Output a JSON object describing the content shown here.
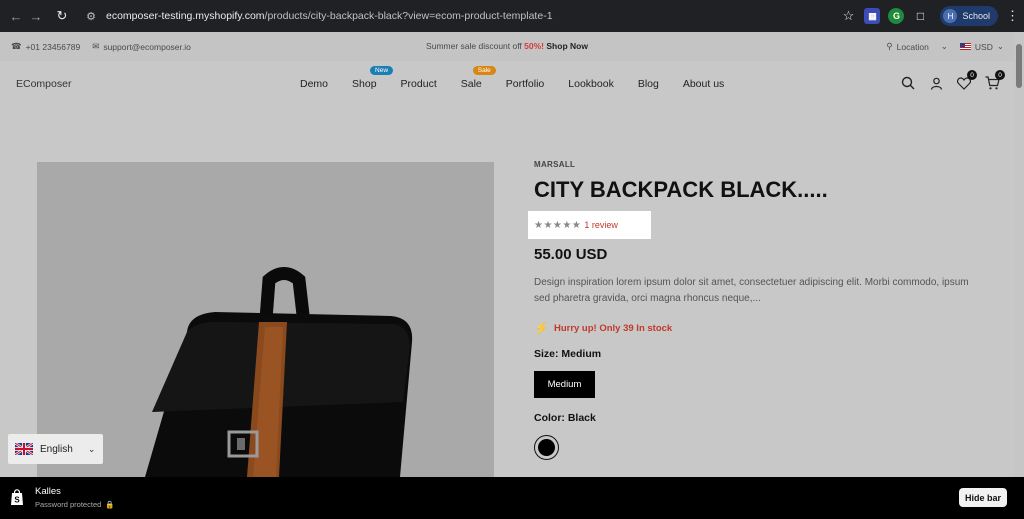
{
  "browser": {
    "url_host": "ecomposer-testing.myshopify.com",
    "url_path": "/products/city-backpack-black?view=ecom-product-template-1",
    "profile_initial": "H",
    "profile_name": "School"
  },
  "topbar": {
    "phone": "+01 23456789",
    "email": "support@ecomposer.io",
    "promo_prefix": "Summer sale discount off ",
    "promo_percent": "50%!",
    "promo_link": "Shop Now",
    "location": "Location",
    "currency": "USD"
  },
  "header": {
    "logo": "EComposer",
    "menu": [
      {
        "label": "Demo"
      },
      {
        "label": "Shop",
        "badge": "New"
      },
      {
        "label": "Product"
      },
      {
        "label": "Sale",
        "badge": "Sale"
      },
      {
        "label": "Portfolio"
      },
      {
        "label": "Lookbook"
      },
      {
        "label": "Blog"
      },
      {
        "label": "About us"
      }
    ],
    "wishlist_count": "0",
    "cart_count": "0"
  },
  "product": {
    "brand": "MARSALL",
    "title": "CITY BACKPACK BLACK.....",
    "rating": 5,
    "review_text": "1 review",
    "price": "55.00 USD",
    "description": "Design inspiration lorem ipsum dolor sit amet, consectetuer adipiscing elit. Morbi commodo, ipsum sed pharetra gravida, orci magna rhoncus neque,...",
    "stock_text": "Hurry up! Only 39 In stock",
    "size_label": "Size: Medium",
    "size_option": "Medium",
    "color_label": "Color: Black"
  },
  "language": {
    "selected": "English"
  },
  "preview_bar": {
    "store_name": "Kalles",
    "status": "Password protected",
    "hide_button": "Hide bar"
  },
  "colors": {
    "accent_red": "#c0392b",
    "badge_new": "#1a7fb3",
    "badge_sale": "#d88615"
  }
}
